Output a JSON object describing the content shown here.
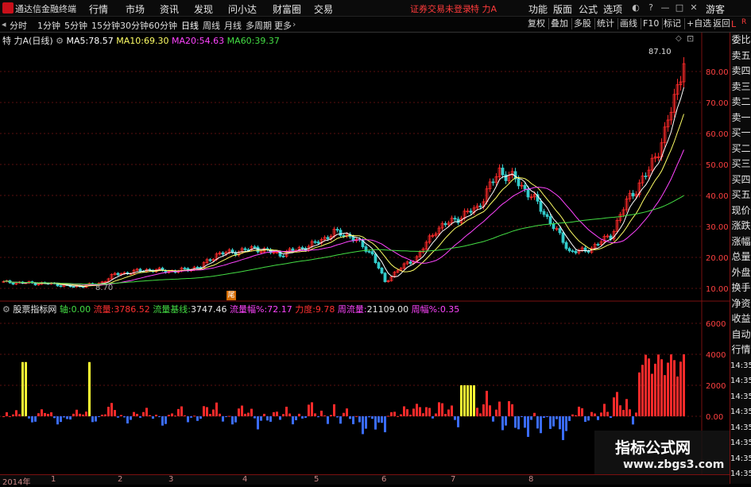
{
  "titlebar": {
    "app_name": "通达信金融终端",
    "menus": [
      "行情",
      "市场",
      "资讯",
      "发现",
      "问小达",
      "财富圈",
      "交易"
    ],
    "login_status": "证券交易未登录",
    "stock_name": "特 力A",
    "right_menus": [
      "功能",
      "版面",
      "公式",
      "选项"
    ],
    "guest": "游客"
  },
  "toolbar": {
    "periods": [
      "分时",
      "1分钟",
      "5分钟",
      "15分钟",
      "30分钟",
      "60分钟",
      "日线",
      "周线",
      "月线",
      "多周期",
      "更多"
    ],
    "active_period": "日线",
    "right_tools": [
      "复权",
      "叠加",
      "多股",
      "统计",
      "画线",
      "F10",
      "标记",
      "+自选",
      "返回"
    ]
  },
  "main_legend": {
    "name": "特 力A",
    "period": "(日线)",
    "ma5_label": "MA5:",
    "ma5_value": "78.57",
    "ma10_label": "MA10:",
    "ma10_value": "69.30",
    "ma20_label": "MA20:",
    "ma20_value": "54.63",
    "ma60_label": "MA60:",
    "ma60_value": "39.37"
  },
  "price_axis": [
    "80.00",
    "70.00",
    "60.00",
    "50.00",
    "40.00",
    "30.00",
    "20.00",
    "10.00"
  ],
  "annotations": {
    "high": "87.10",
    "low": "8.70",
    "marker": "尾"
  },
  "indicator_legend": {
    "name": "股票指标网",
    "axis_label": "轴:",
    "axis_value": "0.00",
    "flow_label": "流量:",
    "flow_value": "3786.52",
    "base_label": "流量基线:",
    "base_value": "3747.46",
    "rate_label": "流量幅%:",
    "rate_value": "72.17",
    "force_label": "力度:",
    "force_value": "9.78",
    "week_label": "周流量:",
    "week_value": "21109.00",
    "week_rate_label": "周幅%:",
    "week_rate_value": "0.35"
  },
  "indicator_axis": [
    "6000",
    "4000",
    "2000",
    "0.00"
  ],
  "right_panel": [
    "委比",
    "卖五",
    "卖四",
    "卖三",
    "卖二",
    "卖一",
    "买一",
    "买二",
    "买三",
    "买四",
    "买五",
    "现价",
    "涨跌",
    "涨幅",
    "总量",
    "外盘",
    "换手",
    "净资",
    "收益",
    "自动",
    "行情",
    "14:35",
    "14:35",
    "14:35",
    "14:35",
    "14:35",
    "14:35",
    "14:35",
    "14:35"
  ],
  "timeline": [
    "2014年",
    "1",
    "2",
    "3",
    "4",
    "5",
    "6",
    "7",
    "8"
  ],
  "watermark": {
    "title": "指标公式网",
    "url": "www.zbgs3.com"
  },
  "colors": {
    "ma5": "#ffffff",
    "ma10": "#ffff66",
    "ma20": "#ff44ff",
    "ma60": "#44dd44",
    "up": "#ff2a2a",
    "down": "#33cccc",
    "accent": "#c8101a"
  }
}
